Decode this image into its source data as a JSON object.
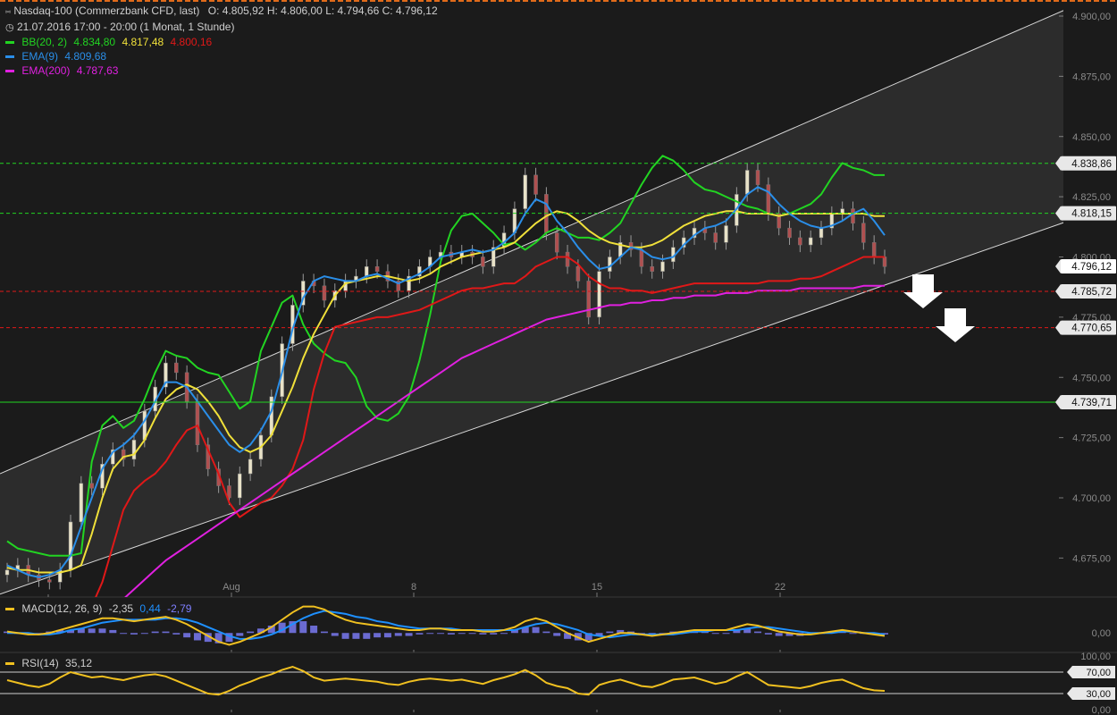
{
  "header": {
    "title": "Nasdaq-100 (Commerzbank CFD, last)",
    "ohlc": "O: 4.805,92  H: 4.806,00  L: 4.794,66  C: 4.796,12",
    "period": "21.07.2016 17:00 - 20:00 (1 Monat, 1 Stunde)"
  },
  "legend": {
    "bb_label": "BB(20, 2)",
    "bb_upper": "4.834,80",
    "bb_mid": "4.817,48",
    "bb_lower": "4.800,16",
    "ema9_label": "EMA(9)",
    "ema9_value": "4.809,68",
    "ema200_label": "EMA(200)",
    "ema200_value": "4.787,63"
  },
  "macd": {
    "label": "MACD(12, 26, 9)",
    "v1": "-2,35",
    "v2": "0,44",
    "v3": "-2,79"
  },
  "rsi": {
    "label": "RSI(14)",
    "value": "35,12"
  },
  "colors": {
    "bb_upper": "#22d422",
    "bb_mid": "#f0e03a",
    "bb_lower": "#e01818",
    "ema9": "#2a8ee8",
    "ema200": "#e020e0",
    "macd": "#f0c020",
    "signal": "#1e90ff",
    "hist": "#7f7fff",
    "rsi": "#f0c020",
    "support_green": "#22d422",
    "resist_green_dash": "#22d422",
    "red_dash": "#e01818"
  },
  "chart_data": {
    "type": "line",
    "ylim": [
      4660,
      4910
    ],
    "y_ticks": [
      "4.900,00",
      "4.875,00",
      "4.850,00",
      "4.825,00",
      "4.800,00",
      "4.775,00",
      "4.750,00",
      "4.725,00",
      "4.700,00",
      "4.675,00"
    ],
    "y_tick_values": [
      4900,
      4875,
      4850,
      4825,
      4800,
      4775,
      4750,
      4725,
      4700,
      4675
    ],
    "x_ticks": [
      "Aug",
      "8",
      "15",
      "22"
    ],
    "price_labels": [
      {
        "text": "4.838,86",
        "value": 4838.86,
        "style": "green-dash"
      },
      {
        "text": "4.818,15",
        "value": 4818.15,
        "style": "green-dash"
      },
      {
        "text": "4.796,12",
        "value": 4796.12,
        "style": "last"
      },
      {
        "text": "4.785,72",
        "value": 4785.72,
        "style": "red-dash"
      },
      {
        "text": "4.770,65",
        "value": 4770.65,
        "style": "red-dash"
      },
      {
        "text": "4.739,71",
        "value": 4739.71,
        "style": "green-solid"
      }
    ],
    "channel": {
      "lower_start": [
        0,
        4660
      ],
      "lower_end": [
        1,
        4822
      ],
      "upper_start": [
        0,
        4710
      ],
      "upper_end": [
        1,
        4912
      ]
    },
    "series": [
      {
        "name": "BB(20, 2)",
        "key": "bb_upper",
        "values": [
          4682,
          4679,
          4678,
          4677,
          4676,
          4676,
          4676,
          4677,
          4715,
          4730,
          4734,
          4729,
          4732,
          4741,
          4752,
          4761,
          4759,
          4758,
          4754,
          4752,
          4751,
          4744,
          4737,
          4740,
          4761,
          4771,
          4781,
          4784,
          4772,
          4764,
          4760,
          4757,
          4756,
          4750,
          4738,
          4733,
          4732,
          4735,
          4742,
          4757,
          4776,
          4798,
          4811,
          4817,
          4818,
          4814,
          4810,
          4805,
          4806,
          4803,
          4806,
          4810,
          4812,
          4810,
          4808,
          4808,
          4807,
          4810,
          4814,
          4822,
          4830,
          4837,
          4842,
          4840,
          4836,
          4831,
          4828,
          4827,
          4825,
          4823,
          4821,
          4820,
          4818,
          4817,
          4818,
          4820,
          4822,
          4826,
          4833,
          4839,
          4837,
          4836,
          4834,
          4834
        ]
      },
      {
        "name": "BB mid",
        "key": "bb_mid",
        "values": [
          4671,
          4670,
          4670,
          4669,
          4669,
          4669,
          4670,
          4672,
          4685,
          4700,
          4712,
          4717,
          4718,
          4724,
          4733,
          4741,
          4745,
          4747,
          4745,
          4740,
          4734,
          4726,
          4721,
          4719,
          4721,
          4726,
          4736,
          4746,
          4758,
          4768,
          4776,
          4784,
          4789,
          4790,
          4791,
          4792,
          4792,
          4791,
          4790,
          4791,
          4793,
          4796,
          4798,
          4800,
          4801,
          4802,
          4803,
          4804,
          4806,
          4810,
          4814,
          4817,
          4819,
          4818,
          4815,
          4811,
          4808,
          4806,
          4805,
          4804,
          4804,
          4805,
          4807,
          4810,
          4813,
          4815,
          4817,
          4818,
          4819,
          4819,
          4818,
          4818,
          4818,
          4817,
          4818,
          4818,
          4818,
          4818,
          4818,
          4818,
          4818,
          4818,
          4817,
          4817
        ]
      },
      {
        "name": "BB lower",
        "key": "bb_lower",
        "values": [
          4645,
          4645,
          4646,
          4646,
          4645,
          4645,
          4645,
          4647,
          4655,
          4665,
          4680,
          4695,
          4703,
          4707,
          4710,
          4715,
          4722,
          4728,
          4730,
          4720,
          4710,
          4698,
          4692,
          4695,
          4698,
          4700,
          4705,
          4712,
          4724,
          4745,
          4760,
          4771,
          4772,
          4773,
          4774,
          4775,
          4775,
          4776,
          4777,
          4778,
          4780,
          4782,
          4784,
          4786,
          4787,
          4787,
          4788,
          4789,
          4789,
          4792,
          4796,
          4798,
          4800,
          4800,
          4797,
          4792,
          4789,
          4787,
          4787,
          4786,
          4786,
          4785,
          4786,
          4787,
          4788,
          4789,
          4789,
          4789,
          4789,
          4789,
          4789,
          4789,
          4790,
          4790,
          4790,
          4791,
          4791,
          4792,
          4794,
          4796,
          4798,
          4800,
          4800,
          4800
        ]
      },
      {
        "name": "EMA(9)",
        "key": "ema9",
        "values": [
          4672,
          4670,
          4668,
          4667,
          4668,
          4670,
          4676,
          4688,
          4700,
          4712,
          4719,
          4722,
          4726,
          4732,
          4740,
          4748,
          4748,
          4746,
          4740,
          4734,
          4728,
          4722,
          4719,
          4722,
          4728,
          4736,
          4752,
          4770,
          4783,
          4790,
          4792,
          4791,
          4790,
          4790,
          4792,
          4793,
          4791,
          4789,
          4791,
          4793,
          4796,
          4800,
          4801,
          4802,
          4803,
          4802,
          4803,
          4806,
          4810,
          4818,
          4824,
          4822,
          4815,
          4810,
          4804,
          4799,
          4795,
          4796,
          4800,
          4804,
          4803,
          4800,
          4799,
          4800,
          4805,
          4809,
          4812,
          4813,
          4815,
          4820,
          4826,
          4829,
          4827,
          4822,
          4818,
          4815,
          4813,
          4812,
          4813,
          4815,
          4818,
          4820,
          4815,
          4809
        ]
      },
      {
        "name": "EMA(200)",
        "key": "ema200",
        "values": [
          4620,
          4623,
          4626,
          4629,
          4632,
          4635,
          4638,
          4642,
          4646,
          4650,
          4654,
          4658,
          4662,
          4666,
          4670,
          4674,
          4677,
          4680,
          4683,
          4686,
          4689,
          4692,
          4695,
          4698,
          4701,
          4704,
          4707,
          4710,
          4713,
          4716,
          4719,
          4722,
          4725,
          4728,
          4731,
          4734,
          4737,
          4740,
          4743,
          4746,
          4749,
          4752,
          4755,
          4758,
          4760,
          4762,
          4764,
          4766,
          4768,
          4770,
          4772,
          4774,
          4775,
          4776,
          4777,
          4778,
          4779,
          4780,
          4780,
          4781,
          4781,
          4782,
          4782,
          4783,
          4783,
          4784,
          4784,
          4784,
          4785,
          4785,
          4785,
          4786,
          4786,
          4786,
          4786,
          4787,
          4787,
          4787,
          4787,
          4787,
          4787,
          4788,
          4788,
          4788
        ]
      },
      {
        "name": "Close",
        "key": "close",
        "values": [
          4670,
          4672,
          4668,
          4666,
          4665,
          4670,
          4690,
          4706,
          4704,
          4714,
          4720,
          4716,
          4724,
          4736,
          4746,
          4756,
          4752,
          4740,
          4722,
          4712,
          4705,
          4700,
          4710,
          4716,
          4726,
          4742,
          4764,
          4780,
          4790,
          4788,
          4782,
          4786,
          4790,
          4792,
          4796,
          4794,
          4790,
          4786,
          4792,
          4796,
          4800,
          4802,
          4800,
          4802,
          4800,
          4796,
          4804,
          4810,
          4820,
          4834,
          4826,
          4810,
          4802,
          4796,
          4790,
          4775,
          4794,
          4800,
          4806,
          4803,
          4796,
          4794,
          4798,
          4804,
          4808,
          4812,
          4810,
          4806,
          4813,
          4826,
          4836,
          4830,
          4818,
          4812,
          4808,
          4805,
          4808,
          4812,
          4818,
          4820,
          4814,
          4806,
          4800,
          4796
        ]
      }
    ],
    "macd_series": {
      "macd": [
        1,
        0,
        -1,
        -1,
        0,
        2,
        4,
        6,
        8,
        10,
        10,
        9,
        8,
        9,
        10,
        11,
        9,
        6,
        2,
        -2,
        -6,
        -8,
        -6,
        -3,
        0,
        4,
        9,
        14,
        18,
        18,
        16,
        12,
        9,
        7,
        6,
        5,
        4,
        3,
        2,
        2,
        3,
        3,
        2,
        2,
        2,
        1,
        1,
        2,
        4,
        8,
        10,
        8,
        4,
        0,
        -3,
        -6,
        -4,
        -2,
        0,
        0,
        -1,
        -2,
        -1,
        0,
        1,
        2,
        2,
        2,
        2,
        4,
        6,
        5,
        3,
        1,
        0,
        -1,
        -1,
        0,
        1,
        2,
        1,
        0,
        -1,
        -2
      ],
      "signal": [
        0,
        0,
        0,
        -1,
        -1,
        0,
        2,
        3,
        5,
        7,
        8,
        9,
        9,
        9,
        9,
        10,
        10,
        9,
        7,
        4,
        1,
        -2,
        -4,
        -4,
        -3,
        -1,
        2,
        6,
        10,
        13,
        15,
        14,
        13,
        11,
        10,
        8,
        7,
        5,
        4,
        3,
        3,
        3,
        3,
        2,
        2,
        2,
        2,
        2,
        2,
        4,
        6,
        7,
        6,
        4,
        2,
        -1,
        -2,
        -3,
        -2,
        -1,
        -1,
        -1,
        -1,
        -1,
        0,
        1,
        1,
        2,
        2,
        2,
        3,
        4,
        4,
        3,
        2,
        1,
        0,
        0,
        0,
        1,
        1,
        0,
        0,
        -1
      ],
      "range": [
        -12,
        22
      ]
    },
    "rsi_series": {
      "values": [
        55,
        50,
        45,
        42,
        48,
        60,
        70,
        65,
        60,
        62,
        58,
        55,
        60,
        64,
        66,
        62,
        54,
        46,
        38,
        30,
        28,
        35,
        45,
        52,
        60,
        66,
        74,
        80,
        72,
        60,
        54,
        56,
        58,
        56,
        54,
        52,
        48,
        46,
        52,
        56,
        58,
        56,
        54,
        56,
        52,
        48,
        55,
        60,
        66,
        74,
        64,
        50,
        44,
        40,
        30,
        28,
        46,
        52,
        56,
        50,
        44,
        42,
        48,
        56,
        58,
        60,
        54,
        48,
        52,
        62,
        70,
        58,
        46,
        44,
        42,
        40,
        44,
        50,
        54,
        56,
        48,
        40,
        36,
        35
      ],
      "ylim": [
        0,
        100
      ],
      "y_ticks": [
        "100,00",
        "70,00",
        "30,00",
        "0,00"
      ],
      "y_tick_values": [
        100,
        70,
        30,
        0
      ]
    }
  }
}
